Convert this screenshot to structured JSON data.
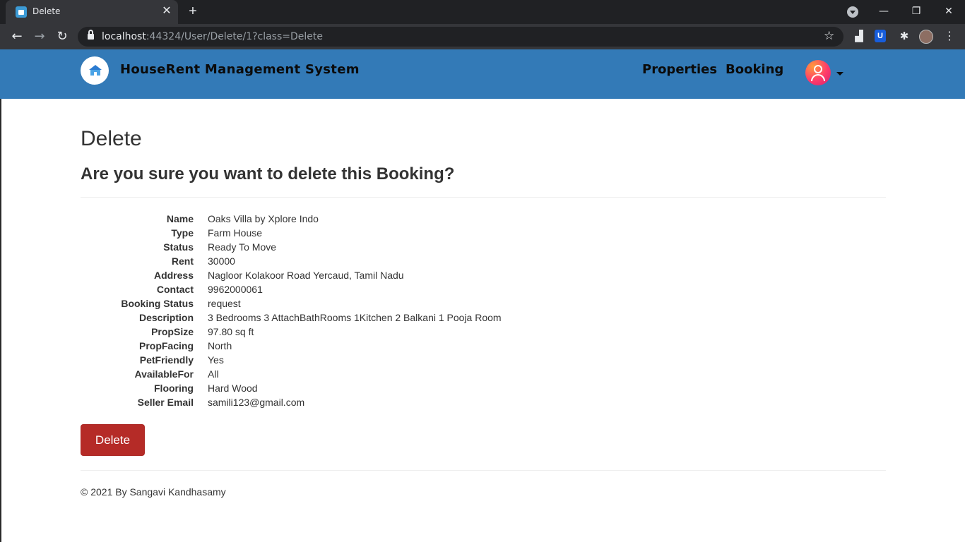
{
  "browser": {
    "tab_title": "Delete",
    "close_glyph": "✕",
    "new_tab_glyph": "+",
    "url_host": "localhost",
    "url_rest": ":44324/User/Delete/1?class=Delete",
    "back_glyph": "←",
    "forward_glyph": "→",
    "reload_glyph": "↻",
    "star_glyph": "☆",
    "menu_glyph": "⋮",
    "minimize_glyph": "—",
    "restore_glyph": "❐",
    "window_close_glyph": "✕"
  },
  "site": {
    "brand": "HouseRent Management System",
    "nav": {
      "properties": "Properties",
      "booking": "Booking"
    },
    "accent_color": "#337ab7"
  },
  "page": {
    "title": "Delete",
    "confirm": "Are you sure you want to delete this Booking?",
    "details": [
      {
        "label": "Name",
        "value": "Oaks Villa by Xplore Indo"
      },
      {
        "label": "Type",
        "value": "Farm House"
      },
      {
        "label": "Status",
        "value": "Ready To Move"
      },
      {
        "label": "Rent",
        "value": "30000"
      },
      {
        "label": "Address",
        "value": "Nagloor Kolakoor Road Yercaud, Tamil Nadu"
      },
      {
        "label": "Contact",
        "value": "9962000061"
      },
      {
        "label": "Booking Status",
        "value": "request"
      },
      {
        "label": "Description",
        "value": "3 Bedrooms 3 AttachBathRooms 1Kitchen 2 Balkani 1 Pooja Room"
      },
      {
        "label": "PropSize",
        "value": "97.80 sq ft"
      },
      {
        "label": "PropFacing",
        "value": "North"
      },
      {
        "label": "PetFriendly",
        "value": "Yes"
      },
      {
        "label": "AvailableFor",
        "value": "All"
      },
      {
        "label": "Flooring",
        "value": "Hard Wood"
      },
      {
        "label": "Seller Email",
        "value": "samili123@gmail.com"
      }
    ],
    "delete_button": "Delete",
    "footer": "© 2021 By Sangavi Kandhasamy"
  }
}
